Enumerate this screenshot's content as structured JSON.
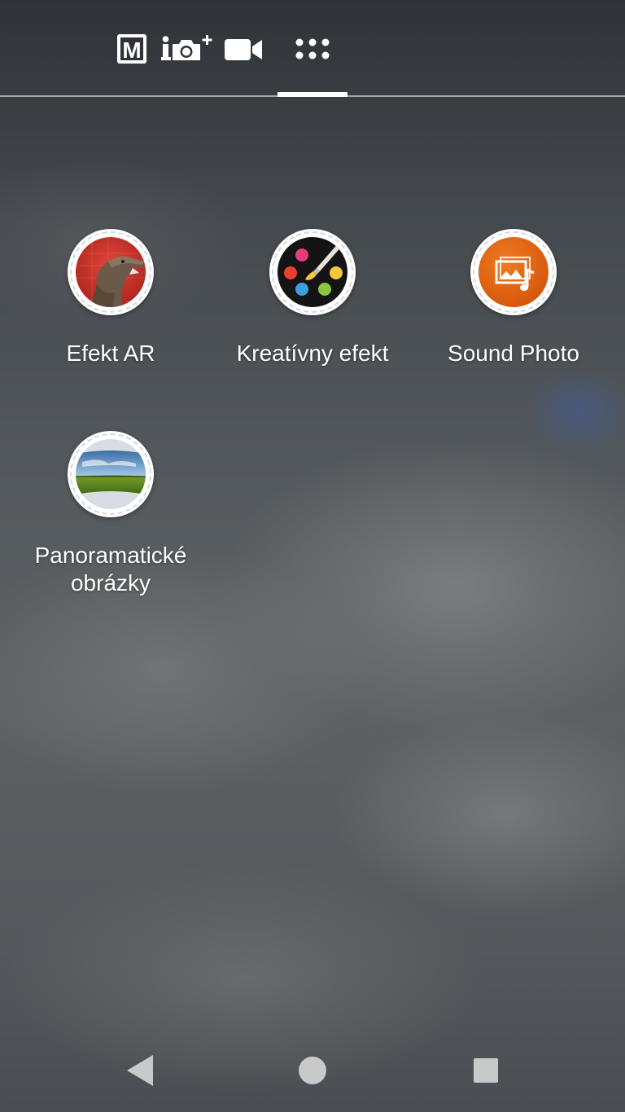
{
  "mode_bar": {
    "modes": [
      {
        "name": "manual",
        "label": "M",
        "icon": "manual-mode-icon"
      },
      {
        "name": "superior-auto",
        "icon": "superior-auto-camera-icon"
      },
      {
        "name": "video",
        "icon": "video-camera-icon"
      },
      {
        "name": "camera-apps",
        "icon": "apps-grid-icon",
        "selected": true
      }
    ]
  },
  "apps": [
    {
      "label": "Efekt AR",
      "icon": "dinosaur-ar-icon"
    },
    {
      "label": "Kreatívny efekt",
      "icon": "paint-palette-icon"
    },
    {
      "label": "Sound Photo",
      "icon": "sound-photo-icon"
    },
    {
      "label_line1": "Panoramatické",
      "label_line2": "obrázky",
      "icon": "panorama-landscape-icon"
    }
  ],
  "nav": {
    "back": "back-icon",
    "home": "home-icon",
    "recents": "recents-icon"
  },
  "colors": {
    "sound_photo_orange": "#e8650f",
    "palette_red": "#e8402f",
    "palette_pink": "#e83a7a",
    "palette_yellow": "#f5c83a",
    "palette_green": "#8cc63f",
    "palette_blue": "#3aa0e0"
  }
}
